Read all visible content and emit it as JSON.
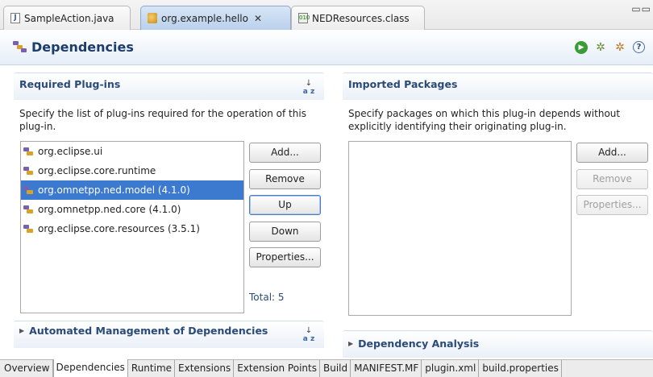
{
  "editor_tabs": [
    {
      "label": "SampleAction.java",
      "icon": "java-file-icon"
    },
    {
      "label": "org.example.hello",
      "icon": "plugin-manifest-icon",
      "close": "✕"
    },
    {
      "label": "NEDResources.class",
      "icon": "class-file-icon"
    }
  ],
  "header": {
    "title": "Dependencies"
  },
  "required": {
    "title": "Required Plug-ins",
    "description": "Specify the list of plug-ins required for the operation of this plug-in.",
    "items": [
      "org.eclipse.ui",
      "org.eclipse.core.runtime",
      "org.omnetpp.ned.model (4.1.0)",
      "org.omnetpp.ned.core (4.1.0)",
      "org.eclipse.core.resources (3.5.1)"
    ],
    "selected_index": 2,
    "buttons": {
      "add": "Add...",
      "remove": "Remove",
      "up": "Up",
      "down": "Down",
      "properties": "Properties..."
    },
    "total": "Total: 5"
  },
  "imported": {
    "title": "Imported Packages",
    "description": "Specify packages on which this plug-in depends without explicitly identifying their originating plug-in.",
    "buttons": {
      "add": "Add...",
      "remove": "Remove",
      "properties": "Properties..."
    }
  },
  "automated": {
    "title": "Automated Management of Dependencies"
  },
  "analysis": {
    "title": "Dependency Analysis"
  },
  "page_tabs": [
    "Overview",
    "Dependencies",
    "Runtime",
    "Extensions",
    "Extension Points",
    "Build",
    "MANIFEST.MF",
    "plugin.xml",
    "build.properties"
  ],
  "active_page_tab": "Dependencies",
  "colors": {
    "selection": "#3c7ad0",
    "section_title": "#2a4a78",
    "header_title": "#1c3c6b"
  }
}
